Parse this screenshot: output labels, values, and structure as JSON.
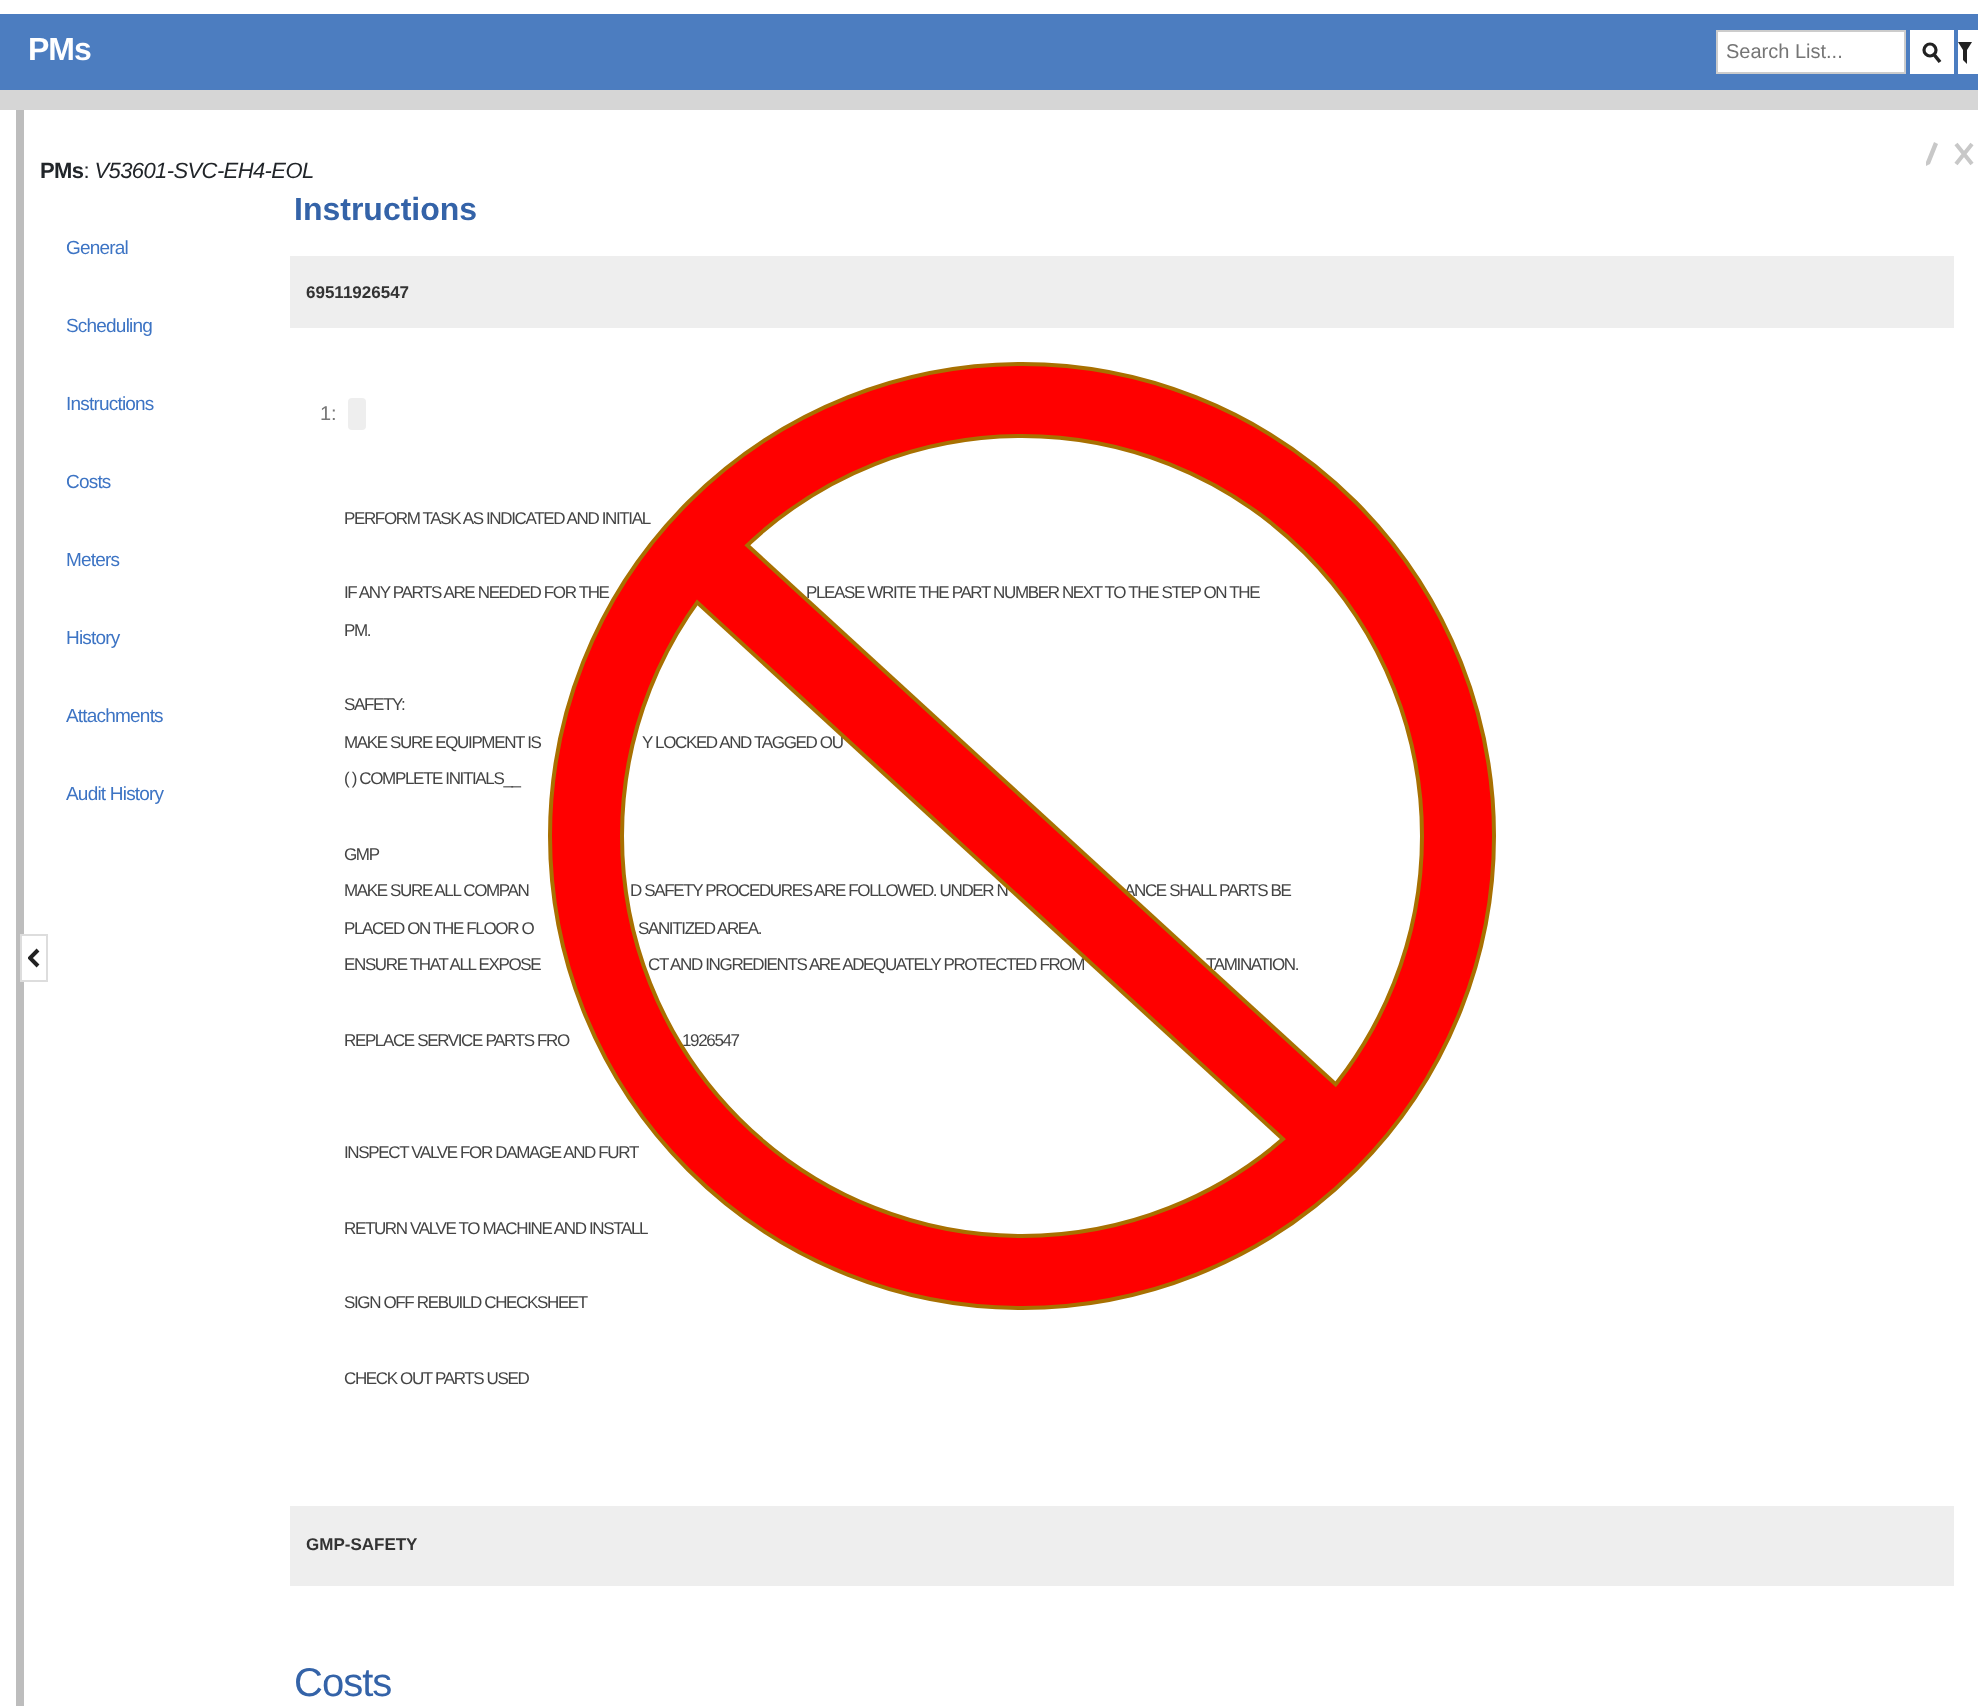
{
  "app": {
    "title": "PMs",
    "search": {
      "placeholder": "Search List..."
    }
  },
  "record": {
    "title": "**PMs**: *V53601-SVC-EH4-EOL*"
  },
  "sidebar": {
    "items": [
      {
        "label": "General"
      },
      {
        "label": "Scheduling"
      },
      {
        "label": "Instructions"
      },
      {
        "label": "Costs"
      },
      {
        "label": "Meters"
      },
      {
        "label": "History"
      },
      {
        "label": "Attachments"
      },
      {
        "label": "Audit History"
      }
    ]
  },
  "section": {
    "heading": "Instructions",
    "code": "69511926547",
    "step_number": "1:",
    "paragraphs": [
      {
        "lines": [
          [
            "PERFORM TASK AS INDICATED AND INITIAL"
          ]
        ]
      },
      {
        "lines": [
          [
            "IF ANY PARTS ARE NEEDED FOR THE",
            "PLEASE WRITE THE PART NUMBER NEXT TO THE STEP ON THE"
          ],
          [
            "PM."
          ]
        ]
      },
      {
        "lines": [
          [
            "SAFETY:"
          ],
          [
            "MAKE SURE EQUIPMENT IS",
            "Y LOCKED AND TAGGED OU"
          ],
          [
            "( ) COMPLETE INITIALS__"
          ]
        ]
      },
      {
        "lines": [
          [
            "GMP"
          ],
          [
            "MAKE SURE ALL COMPAN",
            "D SAFETY PROCEDURES ARE FOLLOWED. UNDER N",
            "ANCE SHALL PARTS BE"
          ],
          [
            "PLACED ON THE FLOOR O",
            "SANITIZED AREA."
          ],
          [
            "ENSURE THAT ALL EXPOSE",
            "CT AND INGREDIENTS ARE ADEQUATELY PROTECTED FROM",
            "TAMINATION."
          ]
        ]
      },
      {
        "lines": [
          [
            "REPLACE SERVICE PARTS FRO",
            "1926547"
          ]
        ]
      },
      {
        "lines": [
          [
            "INSPECT VALVE FOR DAMAGE AND FURT"
          ]
        ]
      },
      {
        "lines": [
          [
            "RETURN VALVE TO MACHINE AND INSTALL"
          ]
        ]
      },
      {
        "lines": [
          [
            "SIGN OFF REBUILD CHECKSHEET"
          ]
        ]
      },
      {
        "lines": [
          [
            "CHECK OUT PARTS USED"
          ]
        ]
      }
    ],
    "footer": "GMP-SAFETY"
  },
  "next_section": {
    "heading": "Costs"
  }
}
